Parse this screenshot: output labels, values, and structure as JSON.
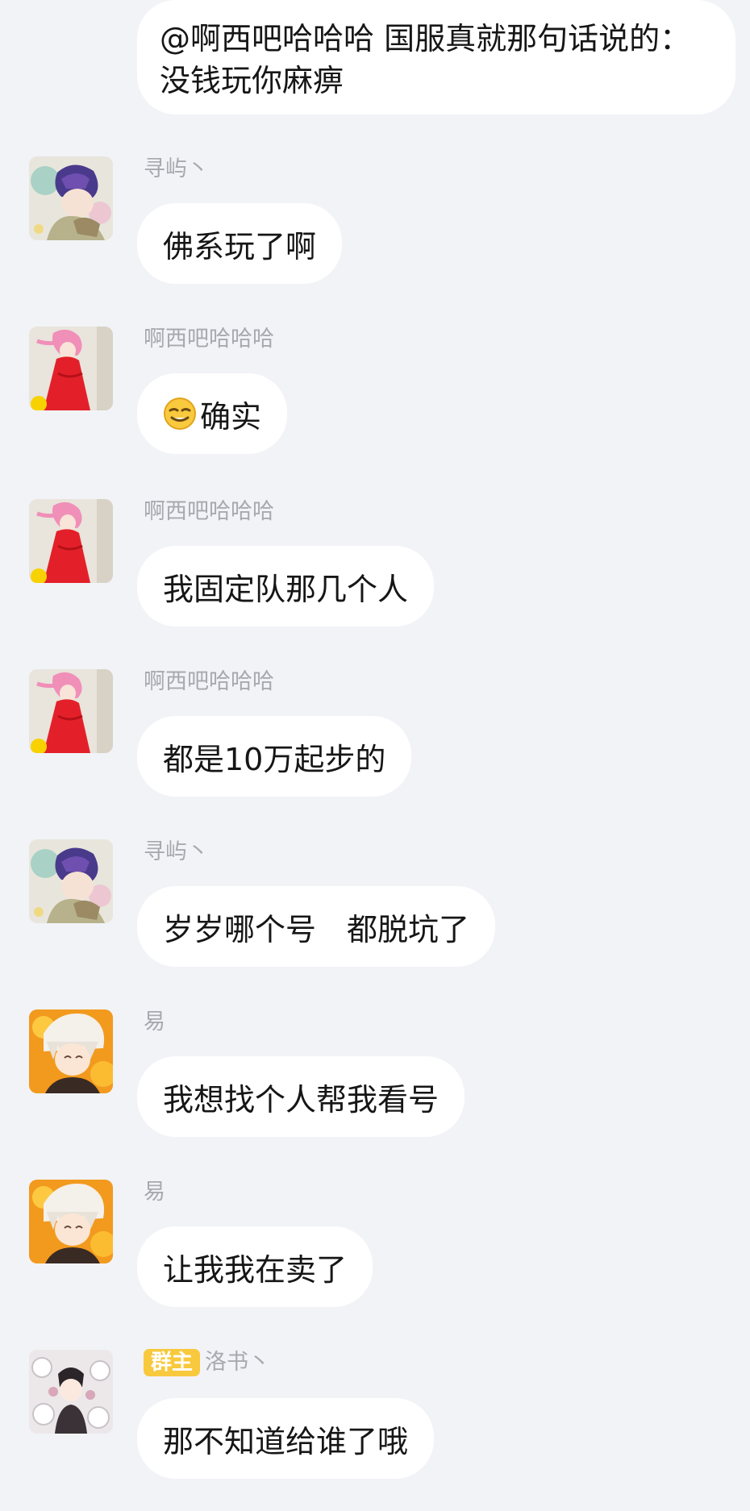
{
  "messages": [
    {
      "sender": "",
      "text": "@啊西吧哈哈哈 国服真就那句话说的：没钱玩你麻痹",
      "avatar": "none"
    },
    {
      "sender": "寻屿丶",
      "text": "佛系玩了啊",
      "avatar": "anime-boy-purple-hair-avatar"
    },
    {
      "sender": "啊西吧哈哈哈",
      "text": "确实",
      "emoji": "smirk-face-icon",
      "avatar": "anime-girl-pink-hair-red-dress-avatar"
    },
    {
      "sender": "啊西吧哈哈哈",
      "text": "我固定队那几个人",
      "avatar": "anime-girl-pink-hair-red-dress-avatar"
    },
    {
      "sender": "啊西吧哈哈哈",
      "text": "都是10万起步的",
      "avatar": "anime-girl-pink-hair-red-dress-avatar"
    },
    {
      "sender": "寻屿丶",
      "text": "岁岁哪个号　都脱坑了",
      "avatar": "anime-boy-purple-hair-avatar"
    },
    {
      "sender": "易",
      "text": "我想找个人帮我看号",
      "avatar": "anime-boy-white-hair-avatar"
    },
    {
      "sender": "易",
      "text": "让我我在卖了",
      "avatar": "anime-boy-white-hair-avatar"
    },
    {
      "sender": "洛书丶",
      "role_badge": "群主",
      "text": "那不知道给谁了哦",
      "avatar": "anime-characters-group-avatar"
    }
  ],
  "colors": {
    "background": "#f2f3f7",
    "bubble": "#ffffff",
    "sender_name": "#a7a9ae",
    "owner_badge": "#f8c93d",
    "message_text": "#161616"
  }
}
